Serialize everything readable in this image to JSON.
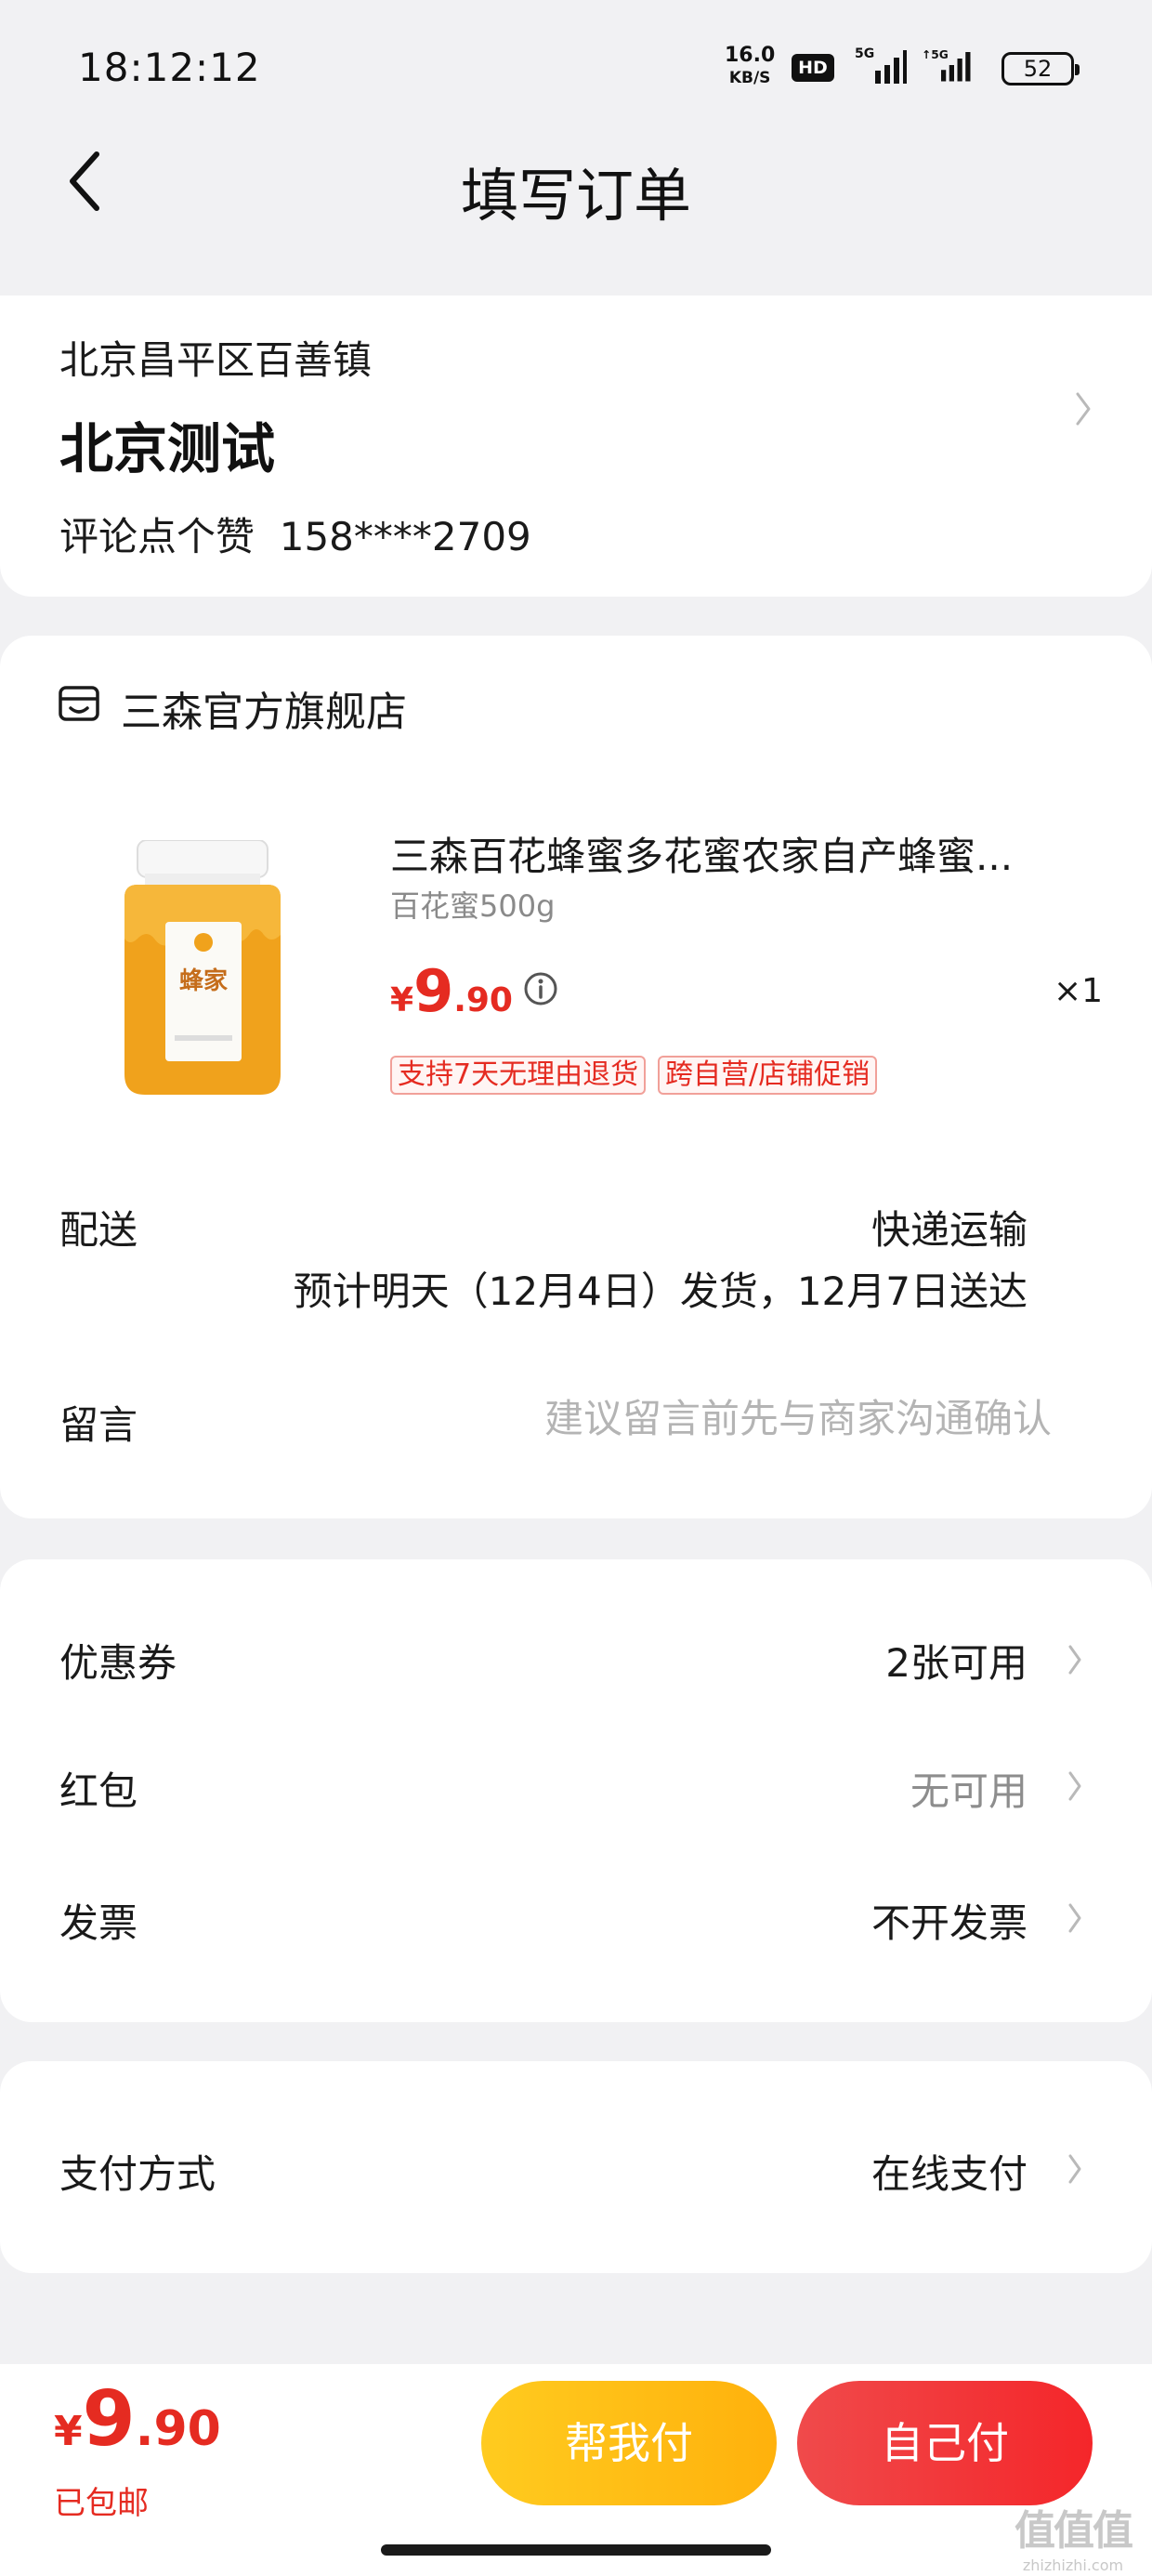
{
  "status_bar": {
    "time": "18:12:12",
    "net_speed": "16.0",
    "net_unit": "KB/S",
    "hd": "HD",
    "battery": "52"
  },
  "header": {
    "title": "填写订单"
  },
  "address": {
    "region": "北京昌平区百善镇",
    "name": "北京测试",
    "contact_name": "评论点个赞",
    "phone": "158****2709"
  },
  "store": {
    "name": "三森官方旗舰店"
  },
  "product": {
    "title": "三森百花蜂蜜多花蜜农家自产蜂蜜...",
    "spec": "百花蜜500g",
    "price_symbol": "¥",
    "price_int": "9",
    "price_dec": ".90",
    "quantity": "×1",
    "tags": [
      "支持7天无理由退货",
      "跨自营/店铺促销"
    ],
    "jar_label": "蜂家"
  },
  "delivery": {
    "label": "配送",
    "method": "快递运输",
    "eta": "预计明天（12月4日）发货，12月7日送达"
  },
  "note": {
    "label": "留言",
    "placeholder": "建议留言前先与商家沟通确认",
    "value": ""
  },
  "promotions": {
    "coupon_label": "优惠券",
    "coupon_value": "2张可用",
    "redpacket_label": "红包",
    "redpacket_value": "无可用",
    "invoice_label": "发票",
    "invoice_value": "不开发票"
  },
  "payment": {
    "label": "支付方式",
    "value": "在线支付"
  },
  "footer": {
    "total_symbol": "¥",
    "total_int": "9",
    "total_dec": ".90",
    "shipping_note": "已包邮",
    "help_pay_label": "帮我付",
    "self_pay_label": "自己付"
  },
  "watermark": {
    "logo": "值值值",
    "site": "zhizhizhi.com"
  },
  "colors": {
    "accent_red": "#e52b21",
    "help_button": "#ffbe16",
    "self_button": "#f2383a",
    "background": "#f1f1f3"
  }
}
